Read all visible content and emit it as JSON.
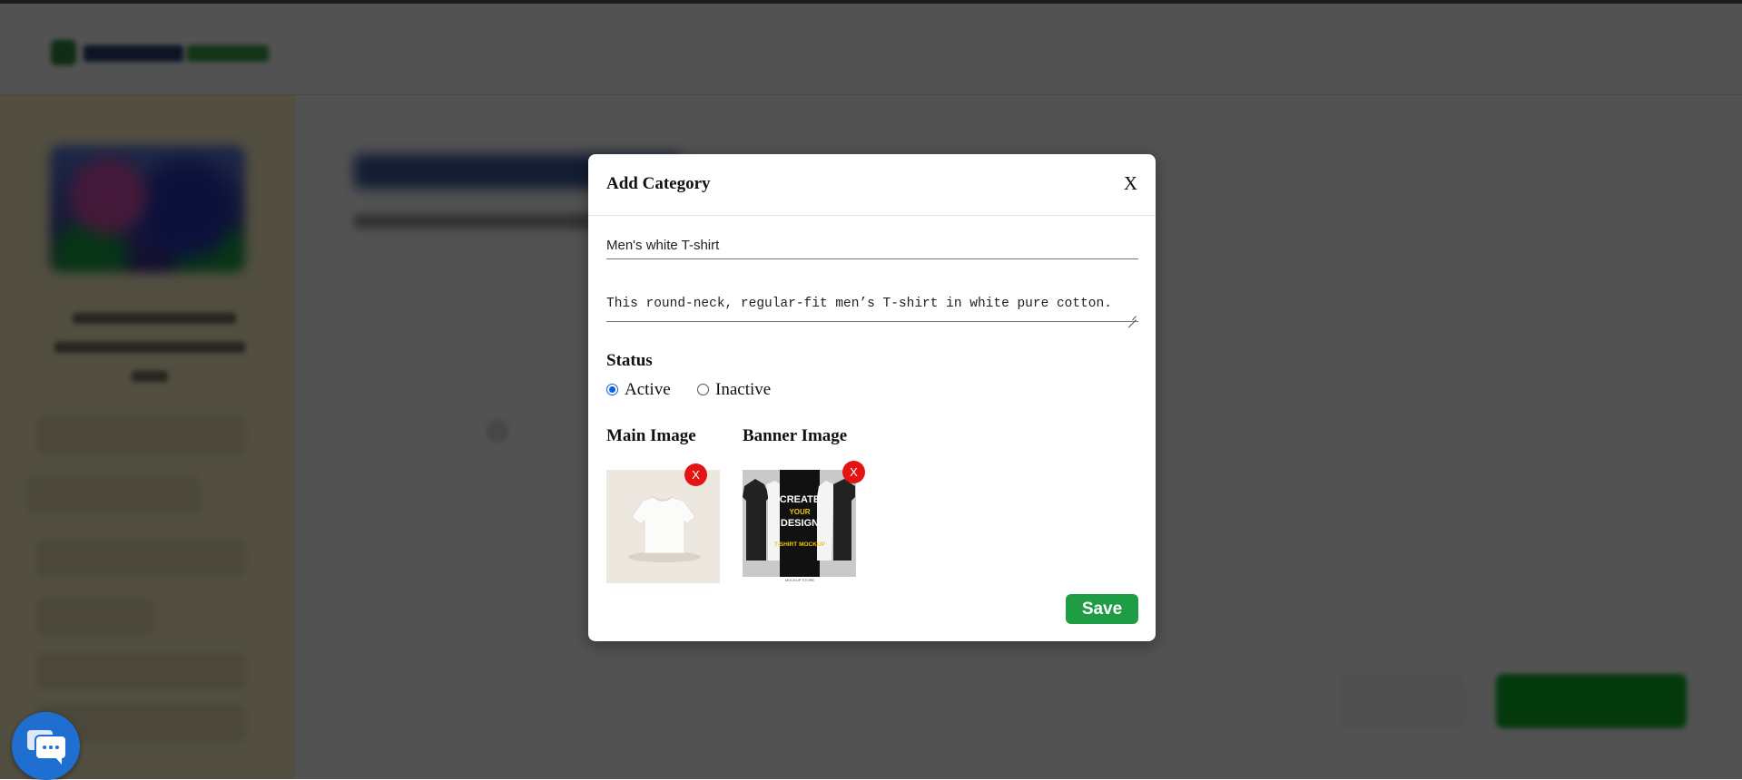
{
  "modal": {
    "title": "Add Category",
    "close_label": "X",
    "name_value": "Men's white T-shirt",
    "description_value": "This round-neck, regular-fit men’s T-shirt in white pure cotton.",
    "status_label": "Status",
    "status_options": [
      {
        "label": "Active",
        "checked": true
      },
      {
        "label": "Inactive",
        "checked": false
      }
    ],
    "main_image_label": "Main Image",
    "banner_image_label": "Banner Image",
    "remove_label": "X",
    "banner_text": [
      "CREATE",
      "YOUR",
      "DESIGN",
      "T-SHIRT MOCKUP"
    ],
    "banner_caption": "MOCKUP STORE",
    "save_label": "Save"
  },
  "colors": {
    "accent_green": "#1f9d45",
    "remove_red": "#e51414",
    "radio_blue": "#0b63d8",
    "chat_blue": "#1e6fd0"
  },
  "icons": {
    "close": "close-icon",
    "chat": "chat-icon",
    "remove": "remove-icon"
  }
}
